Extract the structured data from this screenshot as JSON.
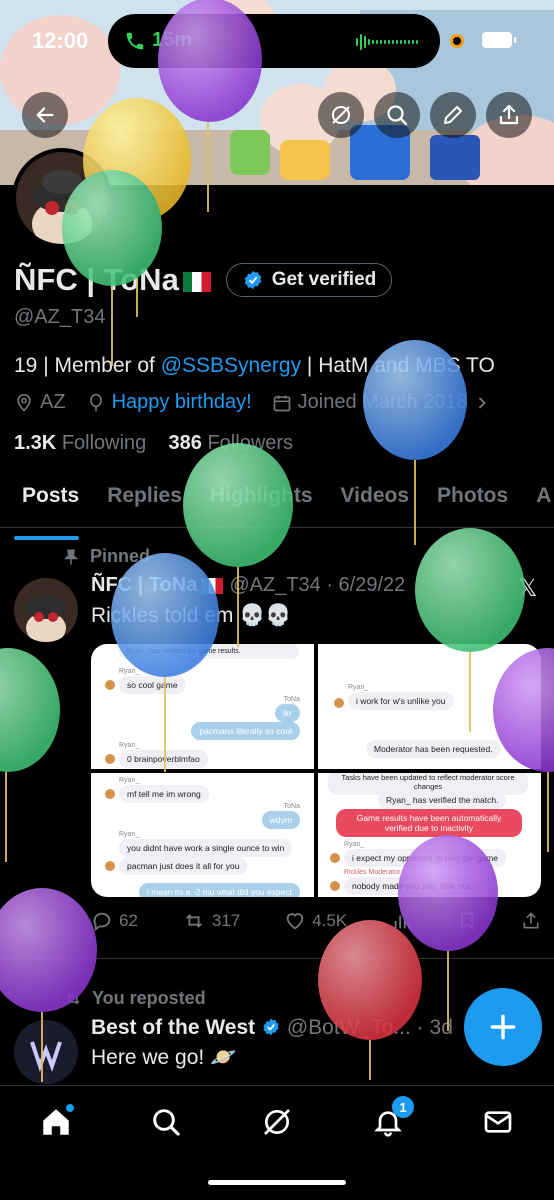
{
  "status_bar": {
    "time": "12:00",
    "call_duration": "15m"
  },
  "profile": {
    "name": "ÑFC | ToNa",
    "verify_label": "Get verified",
    "handle": "@AZ_T34",
    "bio_prefix": "19 | Member of ",
    "bio_link": "@SSBSynergy",
    "bio_suffix": " | HatM and MBS TO",
    "location": "AZ",
    "birthday": "Happy birthday!",
    "joined": "Joined March 2018",
    "following_count": "1.3K",
    "following_label": "Following",
    "followers_count": "386",
    "followers_label": "Followers"
  },
  "tabs": [
    "Posts",
    "Replies",
    "Highlights",
    "Videos",
    "Photos",
    "A"
  ],
  "pinned_post": {
    "pinned_label": "Pinned",
    "author": "ÑFC | ToNa",
    "handle_date": "@AZ_T34 · 6/29/22",
    "text": "Rickles told em 💀💀",
    "replies": "62",
    "reposts": "317",
    "likes": "4.5K",
    "screens": {
      "a": {
        "sys": "Ryan_ has verified the game results.",
        "n1": "Ryan_",
        "m1": "so cool game",
        "n2": "ToNa",
        "m2": "ikr",
        "m3": "pacmans literally so cool",
        "n3": "Ryan_",
        "m4": "0 brainpoverblmfao"
      },
      "b": {
        "n1": "Ryan_",
        "m1": "i work for w's unlike you",
        "sys": "Moderator has been requested."
      },
      "c": {
        "n1": "Ryan_",
        "m1": "mf tell me im wrong",
        "n2": "ToNa",
        "m2": "wdym",
        "n3": "Ryan_",
        "m3": "you didnt have work a single ounce to win",
        "m4": "pacman just does it all for you",
        "m5": "i mean its a -2 mu what did you expect"
      },
      "d": {
        "sys1": "Tasks have been updated to reflect moderator score changes",
        "sys2": "Ryan_ has verified the match.",
        "red": "Game results have been automatically verified due to inactivity",
        "n1": "Ryan_",
        "m1": "i expect my opponent to play the game",
        "n2": "Rickles Moderator",
        "m2": "nobody made you play little mac"
      }
    }
  },
  "repost": {
    "label": "You reposted",
    "author": "Best of the West",
    "handle_time": "@BotW_To... · 3d",
    "text": "Here we go! 🪐"
  },
  "nav": {
    "notifications_badge": "1"
  },
  "colors": {
    "accent": "#1d9bf0",
    "background": "#000000",
    "muted": "#71767b"
  }
}
